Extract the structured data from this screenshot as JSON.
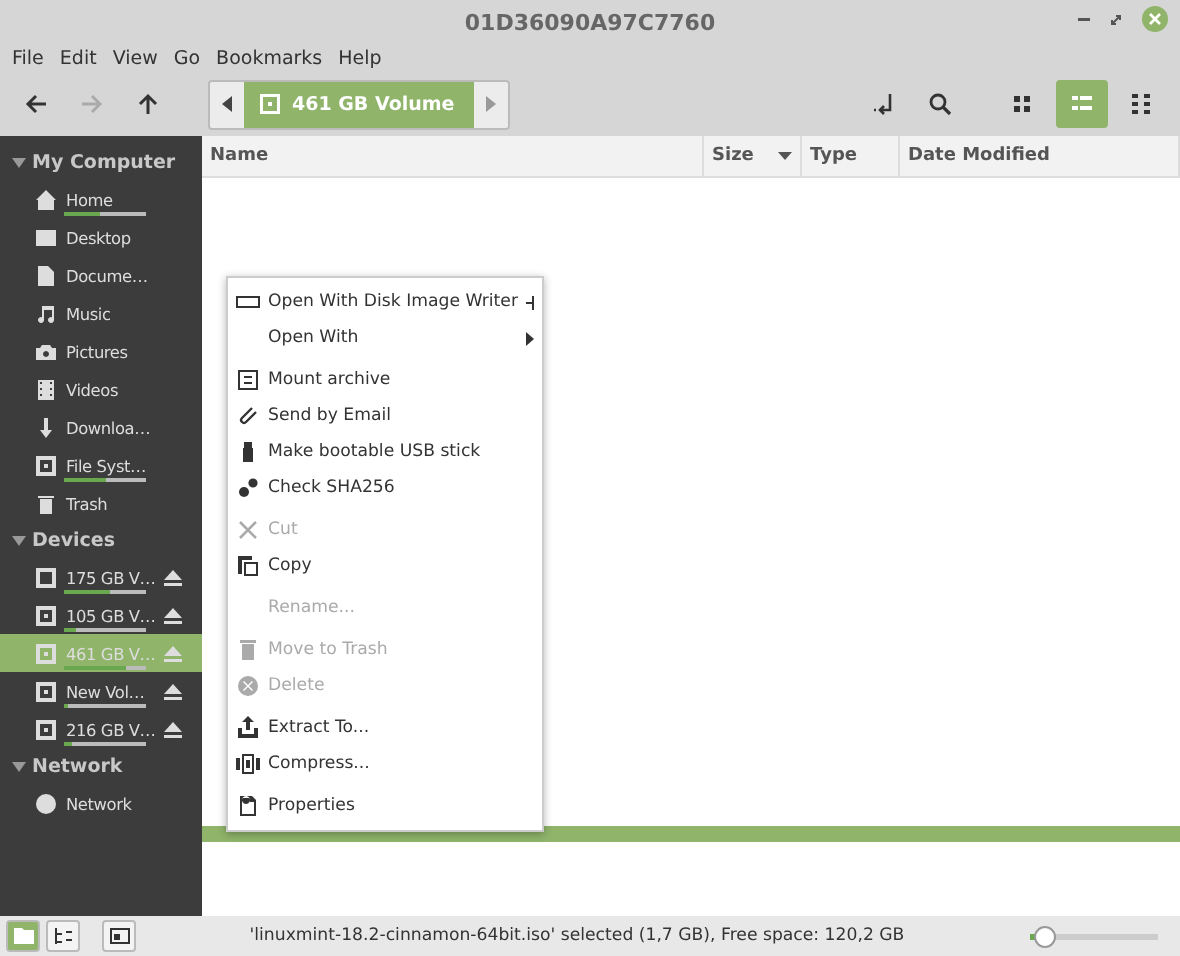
{
  "window": {
    "title": "01D36090A97C7760"
  },
  "menu_bar": [
    "File",
    "Edit",
    "View",
    "Go",
    "Bookmarks",
    "Help"
  ],
  "toolbar": {
    "back_disabled": false,
    "forward_disabled": true,
    "location": "461 GB Volume",
    "views": [
      {
        "kind": "icons",
        "selected": false
      },
      {
        "kind": "list",
        "selected": true
      },
      {
        "kind": "compact",
        "selected": false
      }
    ]
  },
  "sidebar": [
    {
      "title": "My Computer",
      "expanded": true,
      "items": [
        {
          "label": "Home",
          "selected": false,
          "level": 0.45
        },
        {
          "label": "Desktop",
          "selected": false
        },
        {
          "label": "Docume…",
          "selected": false
        },
        {
          "label": "Music",
          "selected": false
        },
        {
          "label": "Pictures",
          "selected": false
        },
        {
          "label": "Videos",
          "selected": false
        },
        {
          "label": "Downloa…",
          "selected": false
        },
        {
          "label": "File Syst…",
          "selected": false,
          "level": 0.5
        },
        {
          "label": "Trash",
          "selected": false
        }
      ]
    },
    {
      "title": "Devices",
      "expanded": true,
      "items": [
        {
          "label": "175 GB V…",
          "selected": false,
          "level": 0.55
        },
        {
          "label": "105 GB V…",
          "selected": false,
          "level": 0.15
        },
        {
          "label": "461 GB V…",
          "selected": true,
          "level": 0.75
        },
        {
          "label": "New Vol…",
          "selected": false,
          "level": 0.04
        },
        {
          "label": "216 GB V…",
          "selected": false,
          "level": 0.1
        }
      ]
    },
    {
      "title": "Network",
      "expanded": true,
      "items": [
        {
          "label": "Network",
          "selected": false
        }
      ]
    }
  ],
  "columns": [
    {
      "label": "Name",
      "sorted": false
    },
    {
      "label": "Size",
      "sorted": true
    },
    {
      "label": "Type",
      "sorted": false
    },
    {
      "label": "Date Modified",
      "sorted": false
    }
  ],
  "context_menu": [
    [
      {
        "label": "Open With Disk Image Writer",
        "disabled": false
      },
      {
        "label": "Open With",
        "disabled": false
      }
    ],
    [
      {
        "label": "Mount archive",
        "disabled": false
      },
      {
        "label": "Send by Email",
        "disabled": false
      },
      {
        "label": "Make bootable USB stick",
        "disabled": false
      },
      {
        "label": "Check SHA256",
        "disabled": false
      }
    ],
    [
      {
        "label": "Cut",
        "disabled": true
      },
      {
        "label": "Copy",
        "disabled": false
      }
    ],
    [
      {
        "label": "Rename...",
        "disabled": true
      }
    ],
    [
      {
        "label": "Move to Trash",
        "disabled": true
      },
      {
        "label": "Delete",
        "disabled": true
      }
    ],
    [
      {
        "label": "Extract To...",
        "disabled": false
      },
      {
        "label": "Compress...",
        "disabled": false
      }
    ],
    [
      {
        "label": "Properties",
        "disabled": false
      }
    ]
  ],
  "status_bar": {
    "panes": [
      {
        "kind": "places",
        "selected": true
      },
      {
        "kind": "tree",
        "selected": false
      }
    ],
    "text": "'linuxmint-18.2-cinnamon-64bit.iso' selected (1,7 GB), Free space: 120,2 GB",
    "zoom": {
      "level": 0.12
    }
  }
}
